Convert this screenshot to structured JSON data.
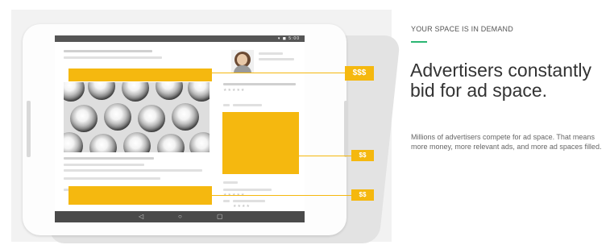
{
  "tablet": {
    "status_icons": "▾ ◼ 5:00",
    "nav": {
      "back": "◁",
      "home": "○",
      "recents": "▢"
    },
    "ratings": {
      "r1": "★★★★★",
      "r2": "★★★★★",
      "r3": "★★★★"
    },
    "ad_tags": {
      "top": "$$$",
      "middle": "$$",
      "bottom": "$$"
    }
  },
  "copy": {
    "kicker": "YOUR SPACE IS IN DEMAND",
    "headline": "Advertisers constantly bid for ad space.",
    "body": "Millions of advertisers compete for ad space. That means more money, more relevant ads, and more ad spaces filled."
  },
  "colors": {
    "ad_yellow": "#f5b80f",
    "accent_green": "#2bb673"
  },
  "icons": [
    "back-icon",
    "home-icon",
    "recents-icon",
    "star-icon"
  ]
}
